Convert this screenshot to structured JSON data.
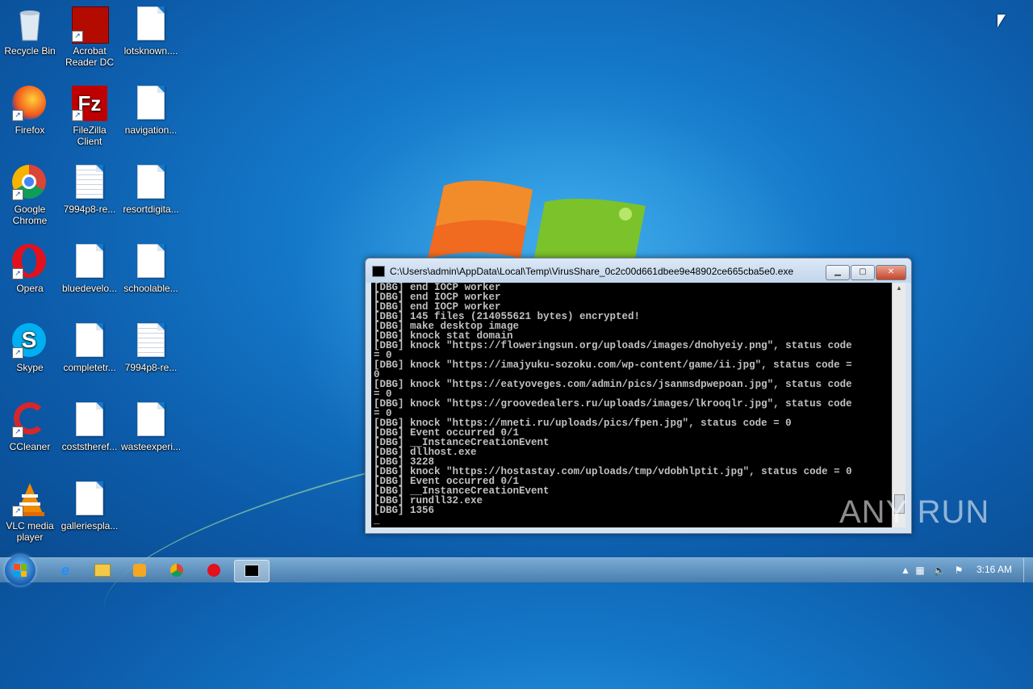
{
  "desktop": {
    "icons": [
      {
        "label": "Recycle Bin",
        "icon": "recycle-bin-icon"
      },
      {
        "label": "Acrobat Reader DC",
        "icon": "acrobat-icon"
      },
      {
        "label": "lotsknown....",
        "icon": "document-icon"
      },
      {
        "label": "Firefox",
        "icon": "firefox-icon"
      },
      {
        "label": "FileZilla Client",
        "icon": "filezilla-icon"
      },
      {
        "label": "navigation...",
        "icon": "document-icon"
      },
      {
        "label": "Google Chrome",
        "icon": "chrome-icon"
      },
      {
        "label": "7994p8-re...",
        "icon": "text-document-icon"
      },
      {
        "label": "resortdigita...",
        "icon": "document-icon"
      },
      {
        "label": "Opera",
        "icon": "opera-icon"
      },
      {
        "label": "bluedevelo...",
        "icon": "document-icon"
      },
      {
        "label": "schoolable...",
        "icon": "document-icon"
      },
      {
        "label": "Skype",
        "icon": "skype-icon"
      },
      {
        "label": "completetr...",
        "icon": "document-icon"
      },
      {
        "label": "7994p8-re...",
        "icon": "text-document-icon"
      },
      {
        "label": "CCleaner",
        "icon": "ccleaner-icon"
      },
      {
        "label": "coststheref...",
        "icon": "document-icon"
      },
      {
        "label": "wasteexperi...",
        "icon": "document-icon"
      },
      {
        "label": "VLC media player",
        "icon": "vlc-icon"
      },
      {
        "label": "galleriespla...",
        "icon": "document-icon"
      }
    ]
  },
  "console": {
    "title": "C:\\Users\\admin\\AppData\\Local\\Temp\\VirusShare_0c2c00d661dbee9e48902ce665cba5e0.exe",
    "lines": [
      "[DBG] end IOCP worker",
      "[DBG] end IOCP worker",
      "[DBG] end IOCP worker",
      "[DBG] 145 files (214055621 bytes) encrypted!",
      "[DBG] make desktop image",
      "[DBG] knock stat domain",
      "[DBG] knock \"https://floweringsun.org/uploads/images/dnohyeiy.png\", status code",
      "= 0",
      "[DBG] knock \"https://imajyuku-sozoku.com/wp-content/game/ii.jpg\", status code =",
      "0",
      "[DBG] knock \"https://eatyoveges.com/admin/pics/jsanmsdpwepoan.jpg\", status code",
      "= 0",
      "[DBG] knock \"https://groovedealers.ru/uploads/images/lkrooqlr.jpg\", status code",
      "= 0",
      "[DBG] knock \"https://mneti.ru/uploads/pics/fpen.jpg\", status code = 0",
      "[DBG] Event occurred 0/1",
      "[DBG] __InstanceCreationEvent",
      "[DBG] dllhost.exe",
      "[DBG] 3228",
      "[DBG] knock \"https://hostastay.com/uploads/tmp/vdobhlptit.jpg\", status code = 0",
      "[DBG] Event occurred 0/1",
      "[DBG] __InstanceCreationEvent",
      "[DBG] rundll32.exe",
      "[DBG] 1356"
    ],
    "cursor": "_"
  },
  "watermark": "ANY RUN",
  "taskbar": {
    "items": [
      "internet-explorer-icon",
      "folder-icon",
      "media-player-icon",
      "chrome-icon",
      "opera-icon",
      "console-icon"
    ],
    "clock": "3:16 AM"
  }
}
